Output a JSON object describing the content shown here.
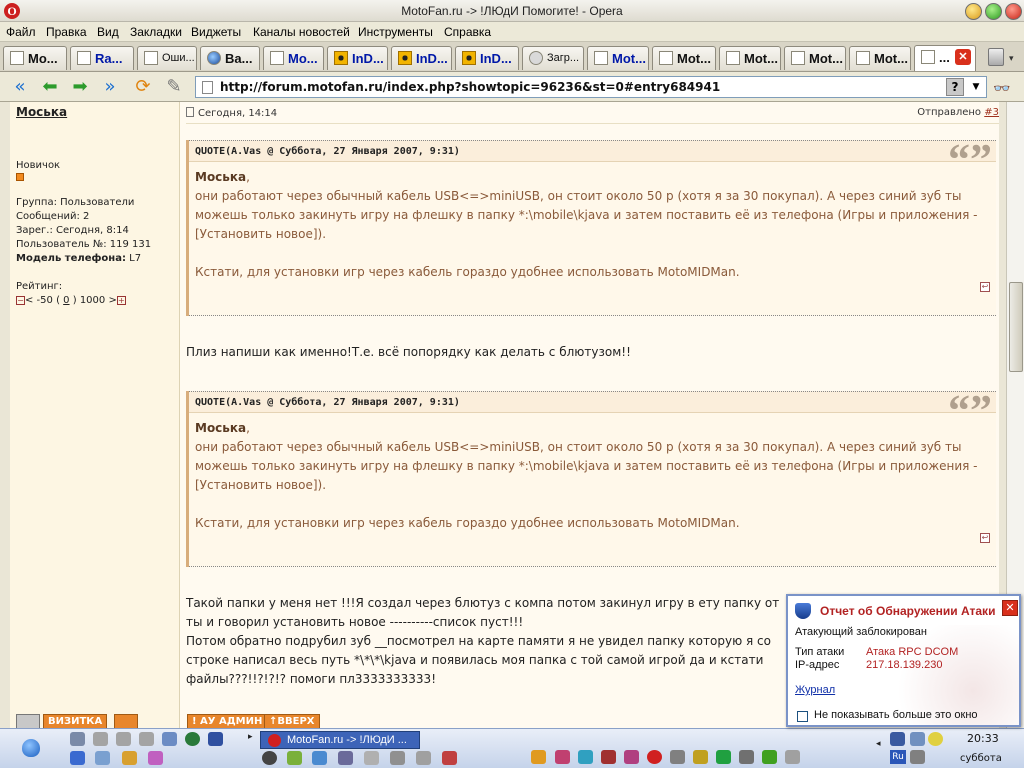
{
  "window": {
    "title": "MotoFan.ru -> !ЛЮдИ Помогите! - Opera",
    "app_logo": "O"
  },
  "menu": [
    "Файл",
    "Правка",
    "Вид",
    "Закладки",
    "Виджеты",
    "Каналы новостей",
    "Инструменты",
    "Справка"
  ],
  "tabs": [
    {
      "label": "Mo...",
      "icon": "page-icon"
    },
    {
      "label": "Ra...",
      "icon": "page-icon"
    },
    {
      "label": "Оши...",
      "icon": "page-icon"
    },
    {
      "label": "Ba...",
      "icon": "globe-icon"
    },
    {
      "label": "Mo...",
      "icon": "page-icon"
    },
    {
      "label": "InD...",
      "icon": "radiation-icon"
    },
    {
      "label": "InD...",
      "icon": "radiation-icon"
    },
    {
      "label": "InD...",
      "icon": "radiation-icon"
    },
    {
      "label": "Загр...",
      "icon": "dish-icon"
    },
    {
      "label": "Mot...",
      "icon": "page-icon"
    },
    {
      "label": "Mot...",
      "icon": "page-icon"
    },
    {
      "label": "Mot...",
      "icon": "page-icon"
    },
    {
      "label": "Mot...",
      "icon": "page-icon"
    },
    {
      "label": "Mot...",
      "icon": "page-icon"
    },
    {
      "label": "...",
      "icon": "page-icon",
      "active": true
    }
  ],
  "address": {
    "url": "http://forum.motofan.ru/index.php?showtopic=96236&st=0#entry684941",
    "help": "?"
  },
  "profile": {
    "username": "Моська",
    "rank": "Новичок",
    "group": "Группа: Пользователи",
    "messages": "Сообщений: 2",
    "registered": "Зарег.: Сегодня, 8:14",
    "user_number": "Пользователь №: 119 131",
    "phone_label": "Модель телефона:",
    "phone_value": "L7",
    "rating_label": "Рейтинг:",
    "rating_min": "< -50 (",
    "rating_value": "0",
    "rating_max": ") 1000 >",
    "minus": "−",
    "plus": "+"
  },
  "post": {
    "date": "Сегодня, 14:14",
    "sent_label": "Отправлено",
    "post_number": "#3",
    "quote_header": "QUOTE(A.Vas @ Суббота, 27 Января 2007, 9:31)",
    "quote_mark": "“”",
    "quote_name": "Моська",
    "quote_p1": "они работают через обычный кабель USB<=>miniUSB, он стоит около 50 р (хотя я за 30 покупал). А через синий зуб ты можешь только закинуть игру на флешку в папку *:\\mobile\\kjava и затем поставить её из телефона (Игры и приложения - [Установить новое]).",
    "quote_p2": "Кстати, для установки игр через кабель гораздо удобнее использовать MotoMIDMan.",
    "reply1": "Плиз напиши как именно!Т.е. всё попорядку как делать с блютузом!!",
    "reply2_l1": "Такой папки у меня нет !!!Я создал через блютуз с компа потом закинул игру в ету папку от",
    "reply2_l2": "ты и говорил установить новое ----------список пуст!!!",
    "reply2_l3": "Потом обратно подрубил зуб __посмотрел на карте памяти я не увидел папку которую я со",
    "reply2_l4": "строке написал весь путь *\\*\\*\\kjava и появилась моя папка с той самой игрой да и кстати",
    "reply2_l5": "файлы???!!?!?!? помоги пл3333333333!"
  },
  "buttons": {
    "card": "ВИЗИТКА",
    "admin": "! АУ АДМИН",
    "top": "↑ВВЕРХ"
  },
  "popup": {
    "title": "Отчет об Обнаружении Атаки",
    "status": "Атакующий заблокирован",
    "attack_type_label": "Тип атаки",
    "attack_type_value": "Атака RPC DCOM",
    "ip_label": "IP-адрес",
    "ip_value": "217.18.139.230",
    "journal_link": "Журнал",
    "dont_show": "Не показывать больше это окно",
    "close": "✕"
  },
  "taskbar": {
    "active_task": "MotoFan.ru -> !ЛЮдИ ...",
    "time": "20:33",
    "day": "суббота",
    "lang": "Ru"
  },
  "colors": {
    "accent_orange": "#e8862c",
    "alert_red": "#b22222",
    "link_blue": "#1030a8"
  }
}
